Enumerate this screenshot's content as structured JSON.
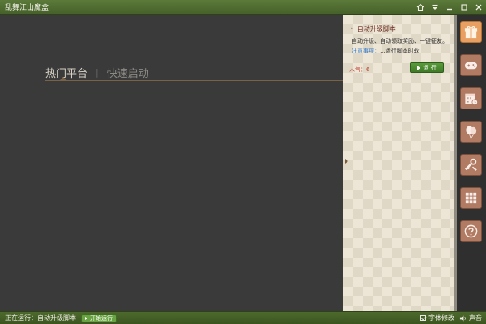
{
  "window": {
    "title": "乱舞江山魔盒"
  },
  "tabs": {
    "active": "热门平台",
    "separator": "|",
    "inactive": "快速启动"
  },
  "card": {
    "title": "自动升级脚本",
    "bullet": "•",
    "description": "自动升级、自动领取奖励、一键征友。",
    "note_label": "注意事项：",
    "note_text": "1.运行脚本时软",
    "popularity": "人气：6",
    "run_label": "运 行"
  },
  "sidebar": {
    "items": [
      {
        "name": "gift-icon",
        "active": true
      },
      {
        "name": "gamepad-icon",
        "active": false
      },
      {
        "name": "calendar-icon",
        "active": false
      },
      {
        "name": "balloon-icon",
        "active": false
      },
      {
        "name": "tools-icon",
        "active": false
      },
      {
        "name": "grid-icon",
        "active": false
      },
      {
        "name": "help-icon",
        "active": false
      }
    ]
  },
  "status": {
    "running": "正在运行：自动升级脚本",
    "start_label": "开始运行",
    "font_label": "字体修改",
    "sound_label": "声音"
  },
  "colors": {
    "titlebar": "#4f6d30",
    "panel": "#ede6d7",
    "accent_btn": "#e8a062",
    "side_btn": "#b07a63",
    "run_btn": "#4a8a30"
  }
}
